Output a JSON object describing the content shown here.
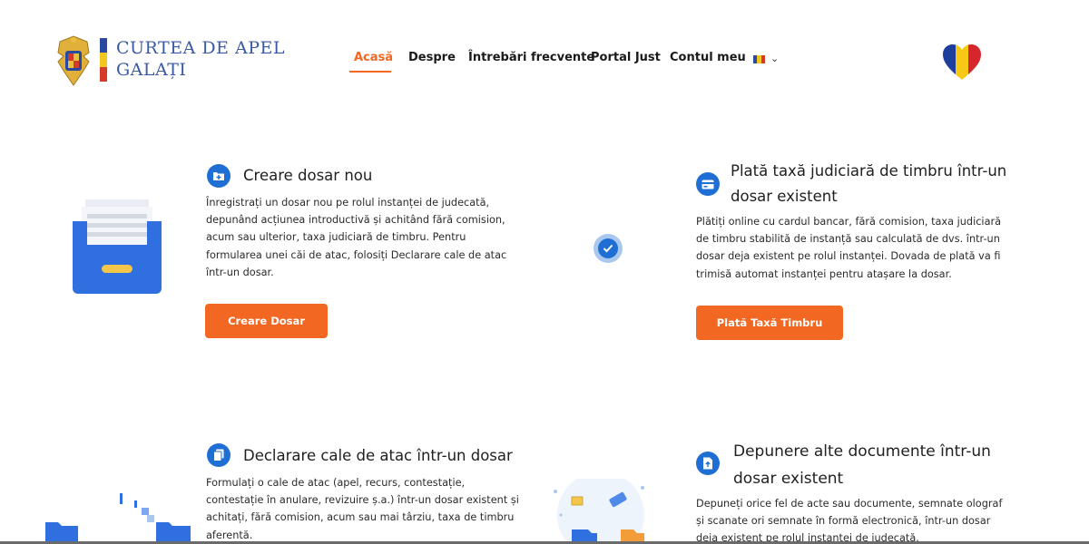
{
  "header": {
    "logo_line1": "CURTEA DE APEL",
    "logo_line2": "GALAȚI",
    "nav": [
      {
        "label": "Acasă",
        "active": true
      },
      {
        "label": "Despre",
        "active": false
      },
      {
        "label": "Întrebări frecvente",
        "active": false
      },
      {
        "label": "Portal Just",
        "active": false
      },
      {
        "label": "Contul meu",
        "active": false
      }
    ],
    "accent_color": "#f26722"
  },
  "cards": [
    {
      "title": "Creare dosar nou",
      "icon": "folder-plus-icon",
      "desc_lines": [
        "Înregistrați un dosar nou pe rolul instanței de judecată,",
        "depunând acțiunea introductivă și achitând fără comision,",
        "acum sau ulterior, taxa judiciară de timbru. Pentru",
        "formularea unei căi de atac, folosiți Declarare cale de atac",
        "într-un dosar."
      ],
      "button": "Creare Dosar"
    },
    {
      "title_lines": [
        "Plată taxă judiciară de timbru într-un",
        "dosar existent"
      ],
      "icon": "card-icon",
      "desc_lines": [
        "Plătiți online cu cardul bancar, fără comision, taxa judiciară",
        "de timbru stabilită de instanță sau calculată de dvs. într-un",
        "dosar deja existent pe rolul instanței. Dovada de plată va fi",
        "trimisă automat instanței pentru atașare la dosar."
      ],
      "button": "Plată Taxă Timbru"
    },
    {
      "title": "Declarare cale de atac într-un dosar",
      "icon": "copy-icon",
      "desc_lines": [
        "Formulați o cale de atac (apel, recurs, contestație,",
        "contestație în anulare, revizuire ș.a.) într-un dosar existent și",
        "achitați, fără comision, acum sau mai târziu, taxa de timbru",
        "aferentă."
      ]
    },
    {
      "title_lines": [
        "Depunere alte documente într-un",
        "dosar existent"
      ],
      "icon": "document-upload-icon",
      "desc_lines": [
        "Depuneți orice fel de acte sau documente, semnate olograf",
        "și scanate ori semnate în formă electronică, într-un dosar",
        "deja existent pe rolul instanței de judecată."
      ]
    }
  ]
}
